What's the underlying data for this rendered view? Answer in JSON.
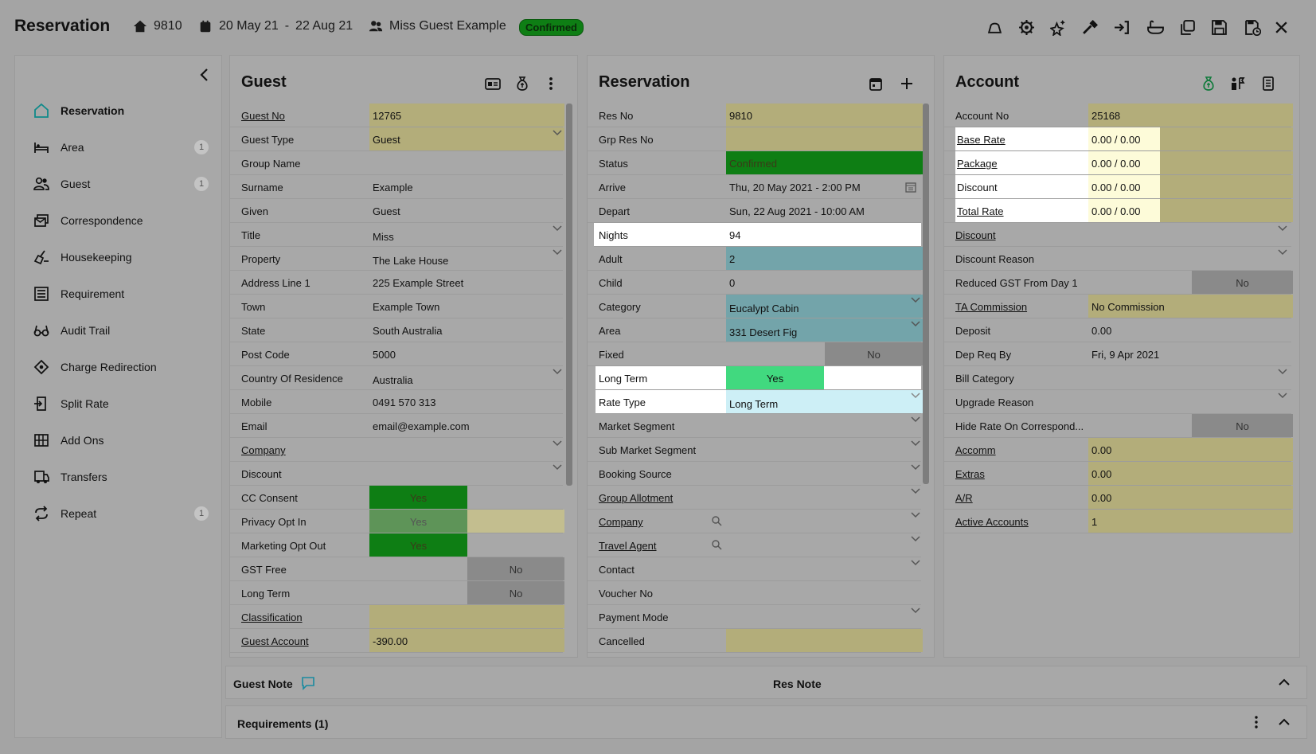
{
  "header": {
    "title": "Reservation",
    "res_no": "9810",
    "date_from": "20 May 21",
    "date_sep": "-",
    "date_to": "22 Aug 21",
    "guest": "Miss Guest Example",
    "status": "Confirmed"
  },
  "toolbar_icons": [
    "bell-icon",
    "settings-icon",
    "star-sparkle-icon",
    "hammer-icon",
    "sign-in-icon",
    "bath-icon",
    "copy-icon",
    "save-icon",
    "save-schedule-icon",
    "close-icon"
  ],
  "sidebar": {
    "items": [
      {
        "label": "Reservation",
        "icon": "home-icon",
        "count": ""
      },
      {
        "label": "Area",
        "icon": "bed-icon",
        "count": "1"
      },
      {
        "label": "Guest",
        "icon": "people-icon",
        "count": "1"
      },
      {
        "label": "Correspondence",
        "icon": "mail-icon",
        "count": ""
      },
      {
        "label": "Housekeeping",
        "icon": "broom-icon",
        "count": ""
      },
      {
        "label": "Requirement",
        "icon": "list-icon",
        "count": ""
      },
      {
        "label": "Audit Trail",
        "icon": "glasses-icon",
        "count": ""
      },
      {
        "label": "Charge Redirection",
        "icon": "diamond-icon",
        "count": ""
      },
      {
        "label": "Split Rate",
        "icon": "split-icon",
        "count": ""
      },
      {
        "label": "Add Ons",
        "icon": "grid-icon",
        "count": ""
      },
      {
        "label": "Transfers",
        "icon": "bus-icon",
        "count": ""
      },
      {
        "label": "Repeat",
        "icon": "repeat-icon",
        "count": "1"
      }
    ]
  },
  "guest": {
    "title": "Guest",
    "rows": [
      {
        "label": "Guest No",
        "value": "12765"
      },
      {
        "label": "Guest Type",
        "value": "Guest"
      },
      {
        "label": "Group Name",
        "value": ""
      },
      {
        "label": "Surname",
        "value": "Example"
      },
      {
        "label": "Given",
        "value": "Guest"
      },
      {
        "label": "Title",
        "value": "Miss"
      },
      {
        "label": "Property",
        "value": "The Lake House"
      },
      {
        "label": "Address Line 1",
        "value": "225 Example Street"
      },
      {
        "label": "Town",
        "value": "Example Town"
      },
      {
        "label": "State",
        "value": "South Australia"
      },
      {
        "label": "Post Code",
        "value": "5000"
      },
      {
        "label": "Country Of Residence",
        "value": "Australia"
      },
      {
        "label": "Mobile",
        "value": "0491 570 313"
      },
      {
        "label": "Email",
        "value": "email@example.com"
      },
      {
        "label": "Company",
        "value": ""
      },
      {
        "label": "Discount",
        "value": ""
      },
      {
        "label": "CC Consent",
        "value": "Yes"
      },
      {
        "label": "Privacy Opt In",
        "value": "Yes"
      },
      {
        "label": "Marketing Opt Out",
        "value": "Yes"
      },
      {
        "label": "GST Free",
        "value": "No"
      },
      {
        "label": "Long Term",
        "value": "No"
      },
      {
        "label": "Classification",
        "value": ""
      },
      {
        "label": "Guest Account",
        "value": "-390.00"
      }
    ]
  },
  "reservation": {
    "title": "Reservation",
    "rows": [
      {
        "label": "Res No",
        "value": "9810"
      },
      {
        "label": "Grp Res No",
        "value": ""
      },
      {
        "label": "Status",
        "value": "Confirmed"
      },
      {
        "label": "Arrive",
        "value": "Thu, 20 May 2021 - 2:00 PM"
      },
      {
        "label": "Depart",
        "value": "Sun, 22 Aug 2021 - 10:00 AM"
      },
      {
        "label": "Nights",
        "value": "94"
      },
      {
        "label": "Adult",
        "value": "2"
      },
      {
        "label": "Child",
        "value": "0"
      },
      {
        "label": "Category",
        "value": "Eucalypt Cabin"
      },
      {
        "label": "Area",
        "value": "331 Desert Fig"
      },
      {
        "label": "Fixed",
        "value": "No"
      },
      {
        "label": "Long Term",
        "value": "Yes"
      },
      {
        "label": "Rate Type",
        "value": "Long Term"
      },
      {
        "label": "Market Segment",
        "value": ""
      },
      {
        "label": "Sub Market Segment",
        "value": ""
      },
      {
        "label": "Booking Source",
        "value": ""
      },
      {
        "label": "Group Allotment",
        "value": ""
      },
      {
        "label": "Company",
        "value": ""
      },
      {
        "label": "Travel Agent",
        "value": ""
      },
      {
        "label": "Contact",
        "value": ""
      },
      {
        "label": "Voucher No",
        "value": ""
      },
      {
        "label": "Payment Mode",
        "value": ""
      },
      {
        "label": "Cancelled",
        "value": ""
      }
    ]
  },
  "account": {
    "title": "Account",
    "rows": [
      {
        "label": "Account No",
        "value": "25168"
      },
      {
        "label": "Base Rate",
        "value": "0.00 / 0.00"
      },
      {
        "label": "Package",
        "value": "0.00 / 0.00"
      },
      {
        "label": "Discount",
        "value": "0.00 / 0.00"
      },
      {
        "label": "Total Rate",
        "value": "0.00 / 0.00"
      },
      {
        "label": "Discount",
        "value": ""
      },
      {
        "label": "Discount Reason",
        "value": ""
      },
      {
        "label": "Reduced GST From Day 1",
        "value": "No"
      },
      {
        "label": "TA Commission",
        "value": "No Commission"
      },
      {
        "label": "Deposit",
        "value": "0.00"
      },
      {
        "label": "Dep Req By",
        "value": "Fri, 9 Apr 2021"
      },
      {
        "label": "Bill Category",
        "value": ""
      },
      {
        "label": "Upgrade Reason",
        "value": ""
      },
      {
        "label": "Hide Rate On Correspond...",
        "value": "No"
      },
      {
        "label": "Accomm",
        "value": "0.00"
      },
      {
        "label": "Extras",
        "value": "0.00"
      },
      {
        "label": "A/R",
        "value": "0.00"
      },
      {
        "label": "Active Accounts",
        "value": "1"
      }
    ]
  },
  "notes": {
    "guest_note": "Guest Note",
    "res_note": "Res Note",
    "requirements": "Requirements (1)"
  },
  "colors": {
    "background": "#a4a4a4",
    "confirmed_green": "#0e7e14",
    "olive_field": "#b3ad7a",
    "teal_field": "#73a4aa",
    "bright_green": "#41d97f",
    "highlight_white": "#ffffff"
  }
}
